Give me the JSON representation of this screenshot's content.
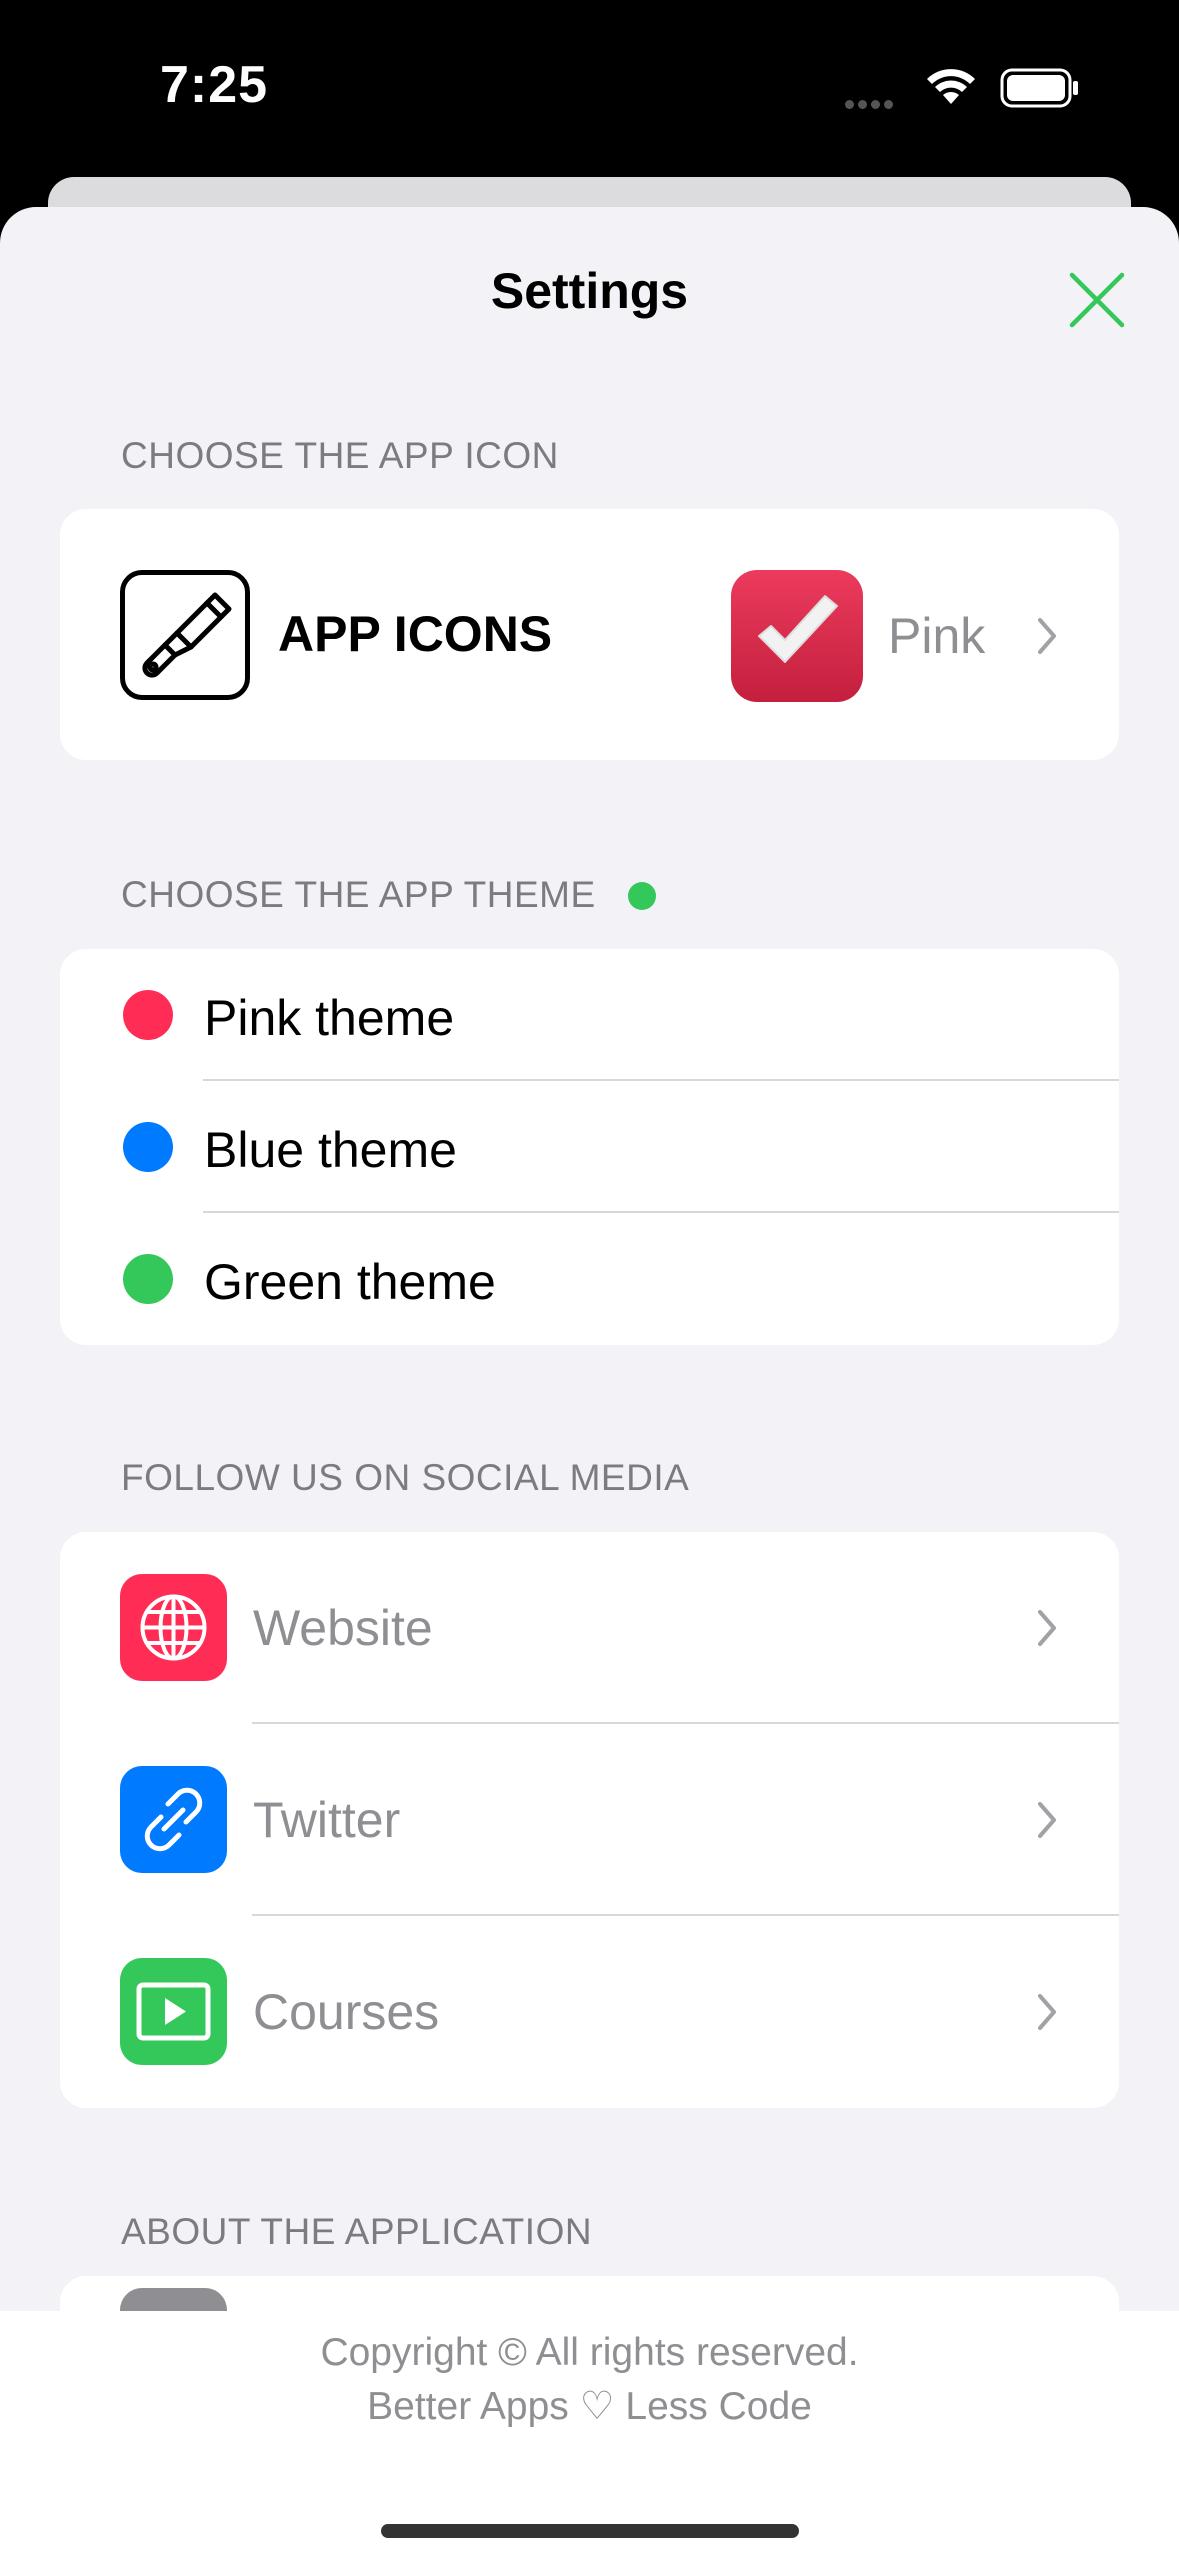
{
  "status_bar": {
    "time": "7:25"
  },
  "nav": {
    "title": "Settings",
    "close_icon": "close-icon",
    "accent": "#34c759"
  },
  "sections": {
    "app_icon": {
      "header": "CHOOSE THE APP ICON",
      "row_label": "APP ICONS",
      "selected_value": "Pink"
    },
    "app_theme": {
      "header": "CHOOSE THE APP THEME",
      "indicator_color": "#34c759",
      "themes": [
        {
          "label": "Pink theme",
          "color": "#ff2d55"
        },
        {
          "label": "Blue theme",
          "color": "#007aff"
        },
        {
          "label": "Green theme",
          "color": "#34c759"
        }
      ]
    },
    "social": {
      "header": "FOLLOW US ON SOCIAL MEDIA",
      "items": [
        {
          "label": "Website",
          "icon": "globe-icon",
          "color": "#ff2d55"
        },
        {
          "label": "Twitter",
          "icon": "link-icon",
          "color": "#007aff"
        },
        {
          "label": "Courses",
          "icon": "play-icon",
          "color": "#34c759"
        }
      ]
    },
    "about": {
      "header": "ABOUT THE APPLICATION"
    }
  },
  "footer": {
    "line1": "Copyright © All rights reserved.",
    "line2": "Better Apps ♡ Less Code"
  }
}
